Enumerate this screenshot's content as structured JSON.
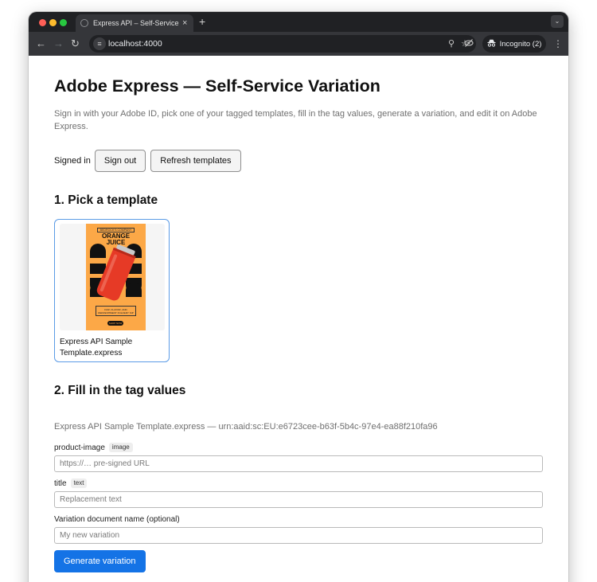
{
  "browser": {
    "tab_title": "Express API – Self-Service Va",
    "tab_close": "×",
    "new_tab": "+",
    "url": "localhost:4000",
    "incognito_label": "Incognito (2)"
  },
  "page": {
    "title": "Adobe Express — Self-Service Variation",
    "intro": "Sign in with your Adobe ID, pick one of your tagged templates, fill in the tag values, generate a variation, and edit it on Adobe Express.",
    "auth": {
      "status": "Signed in",
      "sign_out": "Sign out",
      "refresh": "Refresh templates"
    },
    "step1": {
      "heading": "1. Pick a template",
      "templates": [
        {
          "name": "Express API Sample Template.express",
          "selected": true,
          "thumbnail": {
            "brand": "BEDROCK'S COMPANY",
            "title": "ORANGE\nJUICE",
            "tagline": "FIZZ, FLAVOR, AND REFRESHMENT IN EVERY SIP",
            "cta": "SHOP NOW"
          }
        }
      ]
    },
    "step2": {
      "heading": "2. Fill in the tag values",
      "document_info": "Express API Sample Template.express — urn:aaid:sc:EU:e6723cee-b63f-5b4c-97e4-ea88f210fa96",
      "fields": [
        {
          "label": "product-image",
          "type": "image",
          "value": "",
          "placeholder": "https://… pre-signed URL"
        },
        {
          "label": "title",
          "type": "text",
          "value": "",
          "placeholder": "Replacement text"
        }
      ],
      "variation_name": {
        "label": "Variation document name (optional)",
        "value": "",
        "placeholder": "My new variation"
      },
      "generate": "Generate variation"
    }
  },
  "colors": {
    "primary": "#1473e6",
    "selected_border": "#5b9be6",
    "poster_background": "#fca847",
    "can_red": "#e63a26"
  }
}
